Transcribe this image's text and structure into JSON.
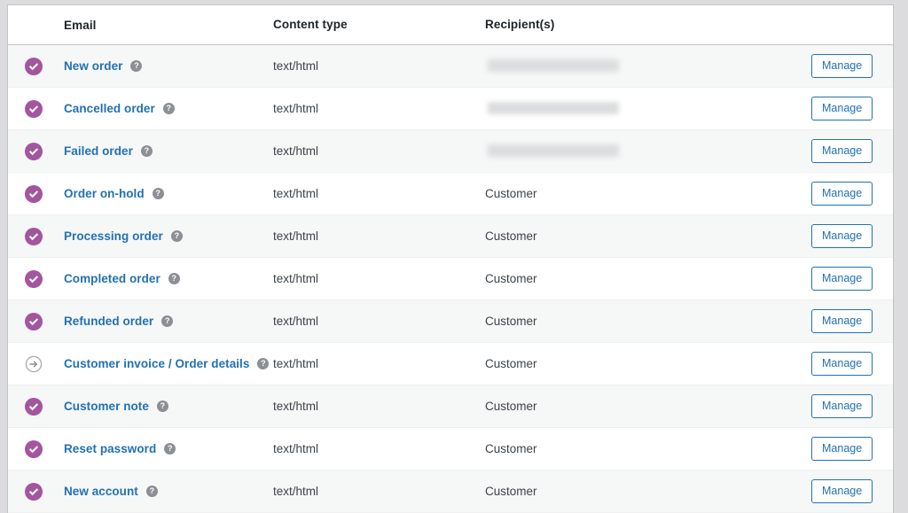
{
  "table": {
    "columns": {
      "status": "",
      "email": "Email",
      "content_type": "Content type",
      "recipients": "Recipient(s)",
      "action": ""
    },
    "action_label": "Manage",
    "help_glyph": "?",
    "colors": {
      "enabled_icon": "#a4559f",
      "disabled_icon": "#8c8f94",
      "link": "#2271b1",
      "button_border": "#2271b1",
      "row_alt_background": "#f6f7f7",
      "page_background": "#dcdcde"
    },
    "rows": [
      {
        "status": "enabled",
        "status_icon": "check-circle-icon",
        "email": "New order",
        "content_type": "text/html",
        "recipient": "",
        "recipient_redacted": true,
        "action": "Manage"
      },
      {
        "status": "enabled",
        "status_icon": "check-circle-icon",
        "email": "Cancelled order",
        "content_type": "text/html",
        "recipient": "",
        "recipient_redacted": true,
        "action": "Manage"
      },
      {
        "status": "enabled",
        "status_icon": "check-circle-icon",
        "email": "Failed order",
        "content_type": "text/html",
        "recipient": "",
        "recipient_redacted": true,
        "action": "Manage"
      },
      {
        "status": "enabled",
        "status_icon": "check-circle-icon",
        "email": "Order on-hold",
        "content_type": "text/html",
        "recipient": "Customer",
        "recipient_redacted": false,
        "action": "Manage"
      },
      {
        "status": "enabled",
        "status_icon": "check-circle-icon",
        "email": "Processing order",
        "content_type": "text/html",
        "recipient": "Customer",
        "recipient_redacted": false,
        "action": "Manage"
      },
      {
        "status": "enabled",
        "status_icon": "check-circle-icon",
        "email": "Completed order",
        "content_type": "text/html",
        "recipient": "Customer",
        "recipient_redacted": false,
        "action": "Manage"
      },
      {
        "status": "enabled",
        "status_icon": "check-circle-icon",
        "email": "Refunded order",
        "content_type": "text/html",
        "recipient": "Customer",
        "recipient_redacted": false,
        "action": "Manage"
      },
      {
        "status": "manual",
        "status_icon": "arrow-circle-icon",
        "email": "Customer invoice / Order details",
        "content_type": "text/html",
        "recipient": "Customer",
        "recipient_redacted": false,
        "action": "Manage"
      },
      {
        "status": "enabled",
        "status_icon": "check-circle-icon",
        "email": "Customer note",
        "content_type": "text/html",
        "recipient": "Customer",
        "recipient_redacted": false,
        "action": "Manage"
      },
      {
        "status": "enabled",
        "status_icon": "check-circle-icon",
        "email": "Reset password",
        "content_type": "text/html",
        "recipient": "Customer",
        "recipient_redacted": false,
        "action": "Manage"
      },
      {
        "status": "enabled",
        "status_icon": "check-circle-icon",
        "email": "New account",
        "content_type": "text/html",
        "recipient": "Customer",
        "recipient_redacted": false,
        "action": "Manage"
      }
    ]
  }
}
